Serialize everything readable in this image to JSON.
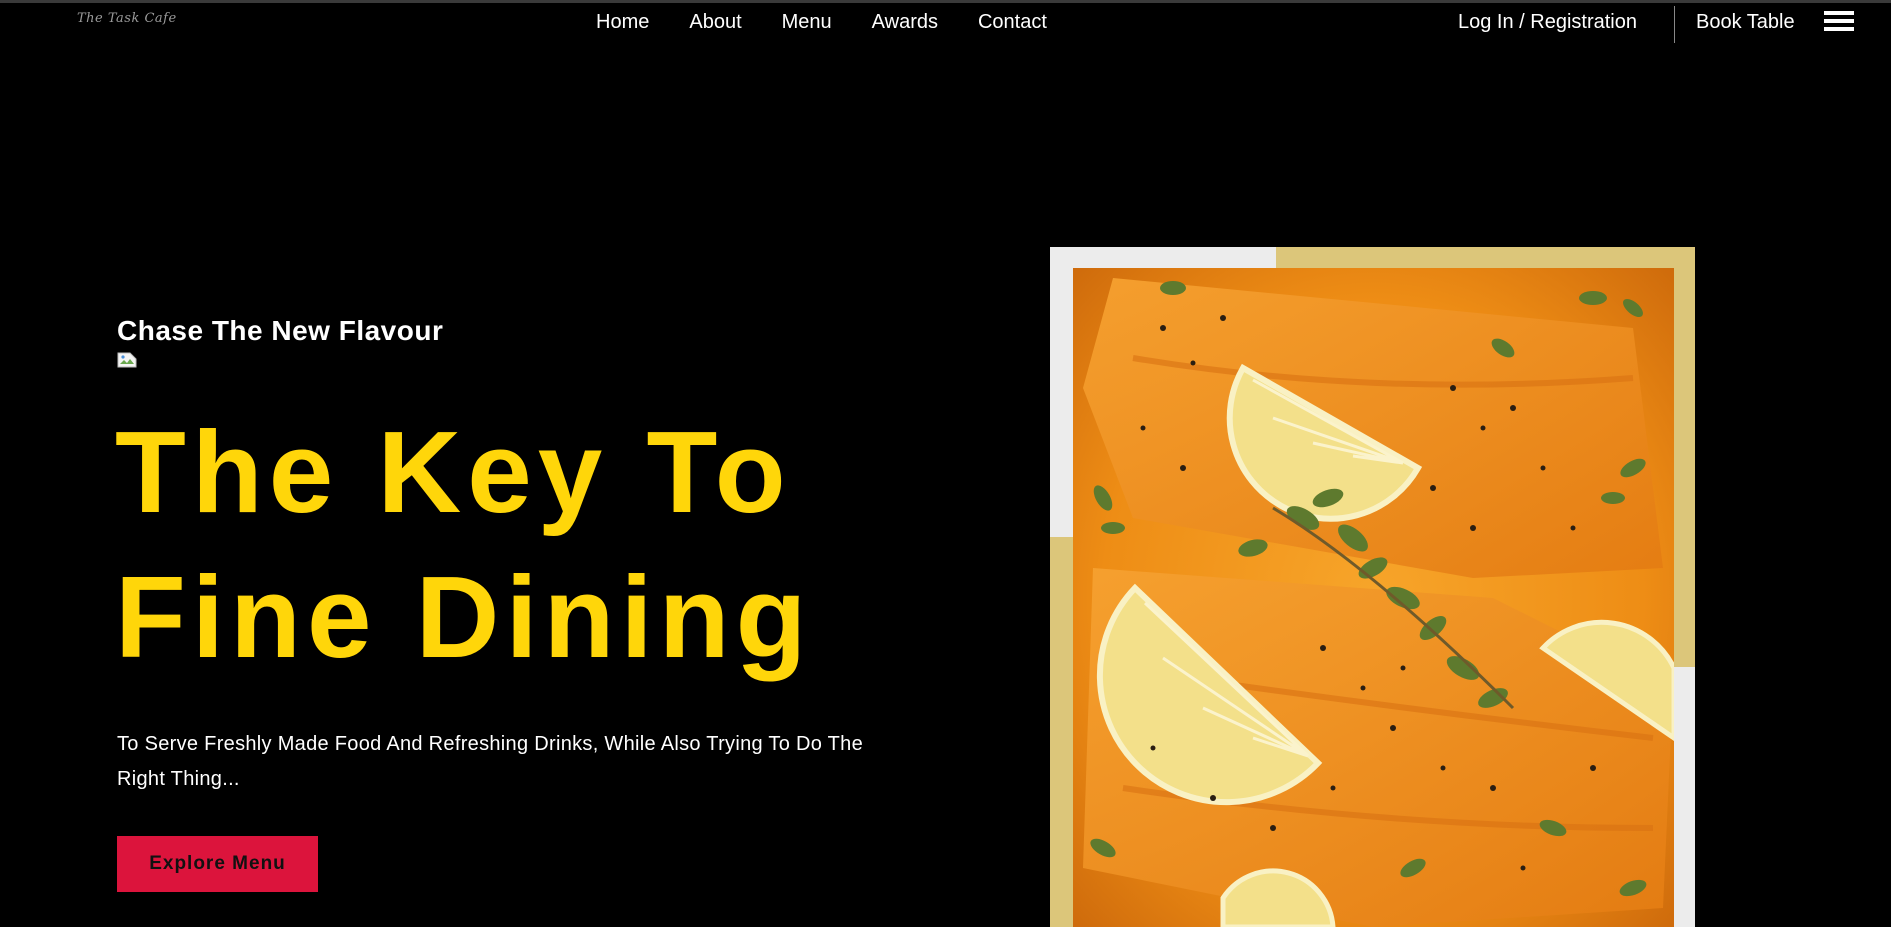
{
  "brand": {
    "logo_text": "The Task Cafe"
  },
  "nav": {
    "links": [
      "Home",
      "About",
      "Menu",
      "Awards",
      "Contact"
    ],
    "login_label": "Log In / Registration",
    "book_label": "Book Table",
    "menu_icon": "hamburger-icon"
  },
  "hero": {
    "eyebrow": "Chase The New Flavour",
    "headline_line1": "The Key To",
    "headline_line2": "Fine Dining",
    "description": "To Serve Freshly Made Food And Refreshing Drinks, While Also Trying To Do The Right Thing...",
    "cta_label": "Explore Menu",
    "image_icon": "broken-image-icon"
  },
  "colors": {
    "background": "#000000",
    "accent_yellow": "#FFD60A",
    "cta_red": "#DC143C",
    "frame_gold": "#DCC67A",
    "frame_white": "#ECECEC"
  }
}
